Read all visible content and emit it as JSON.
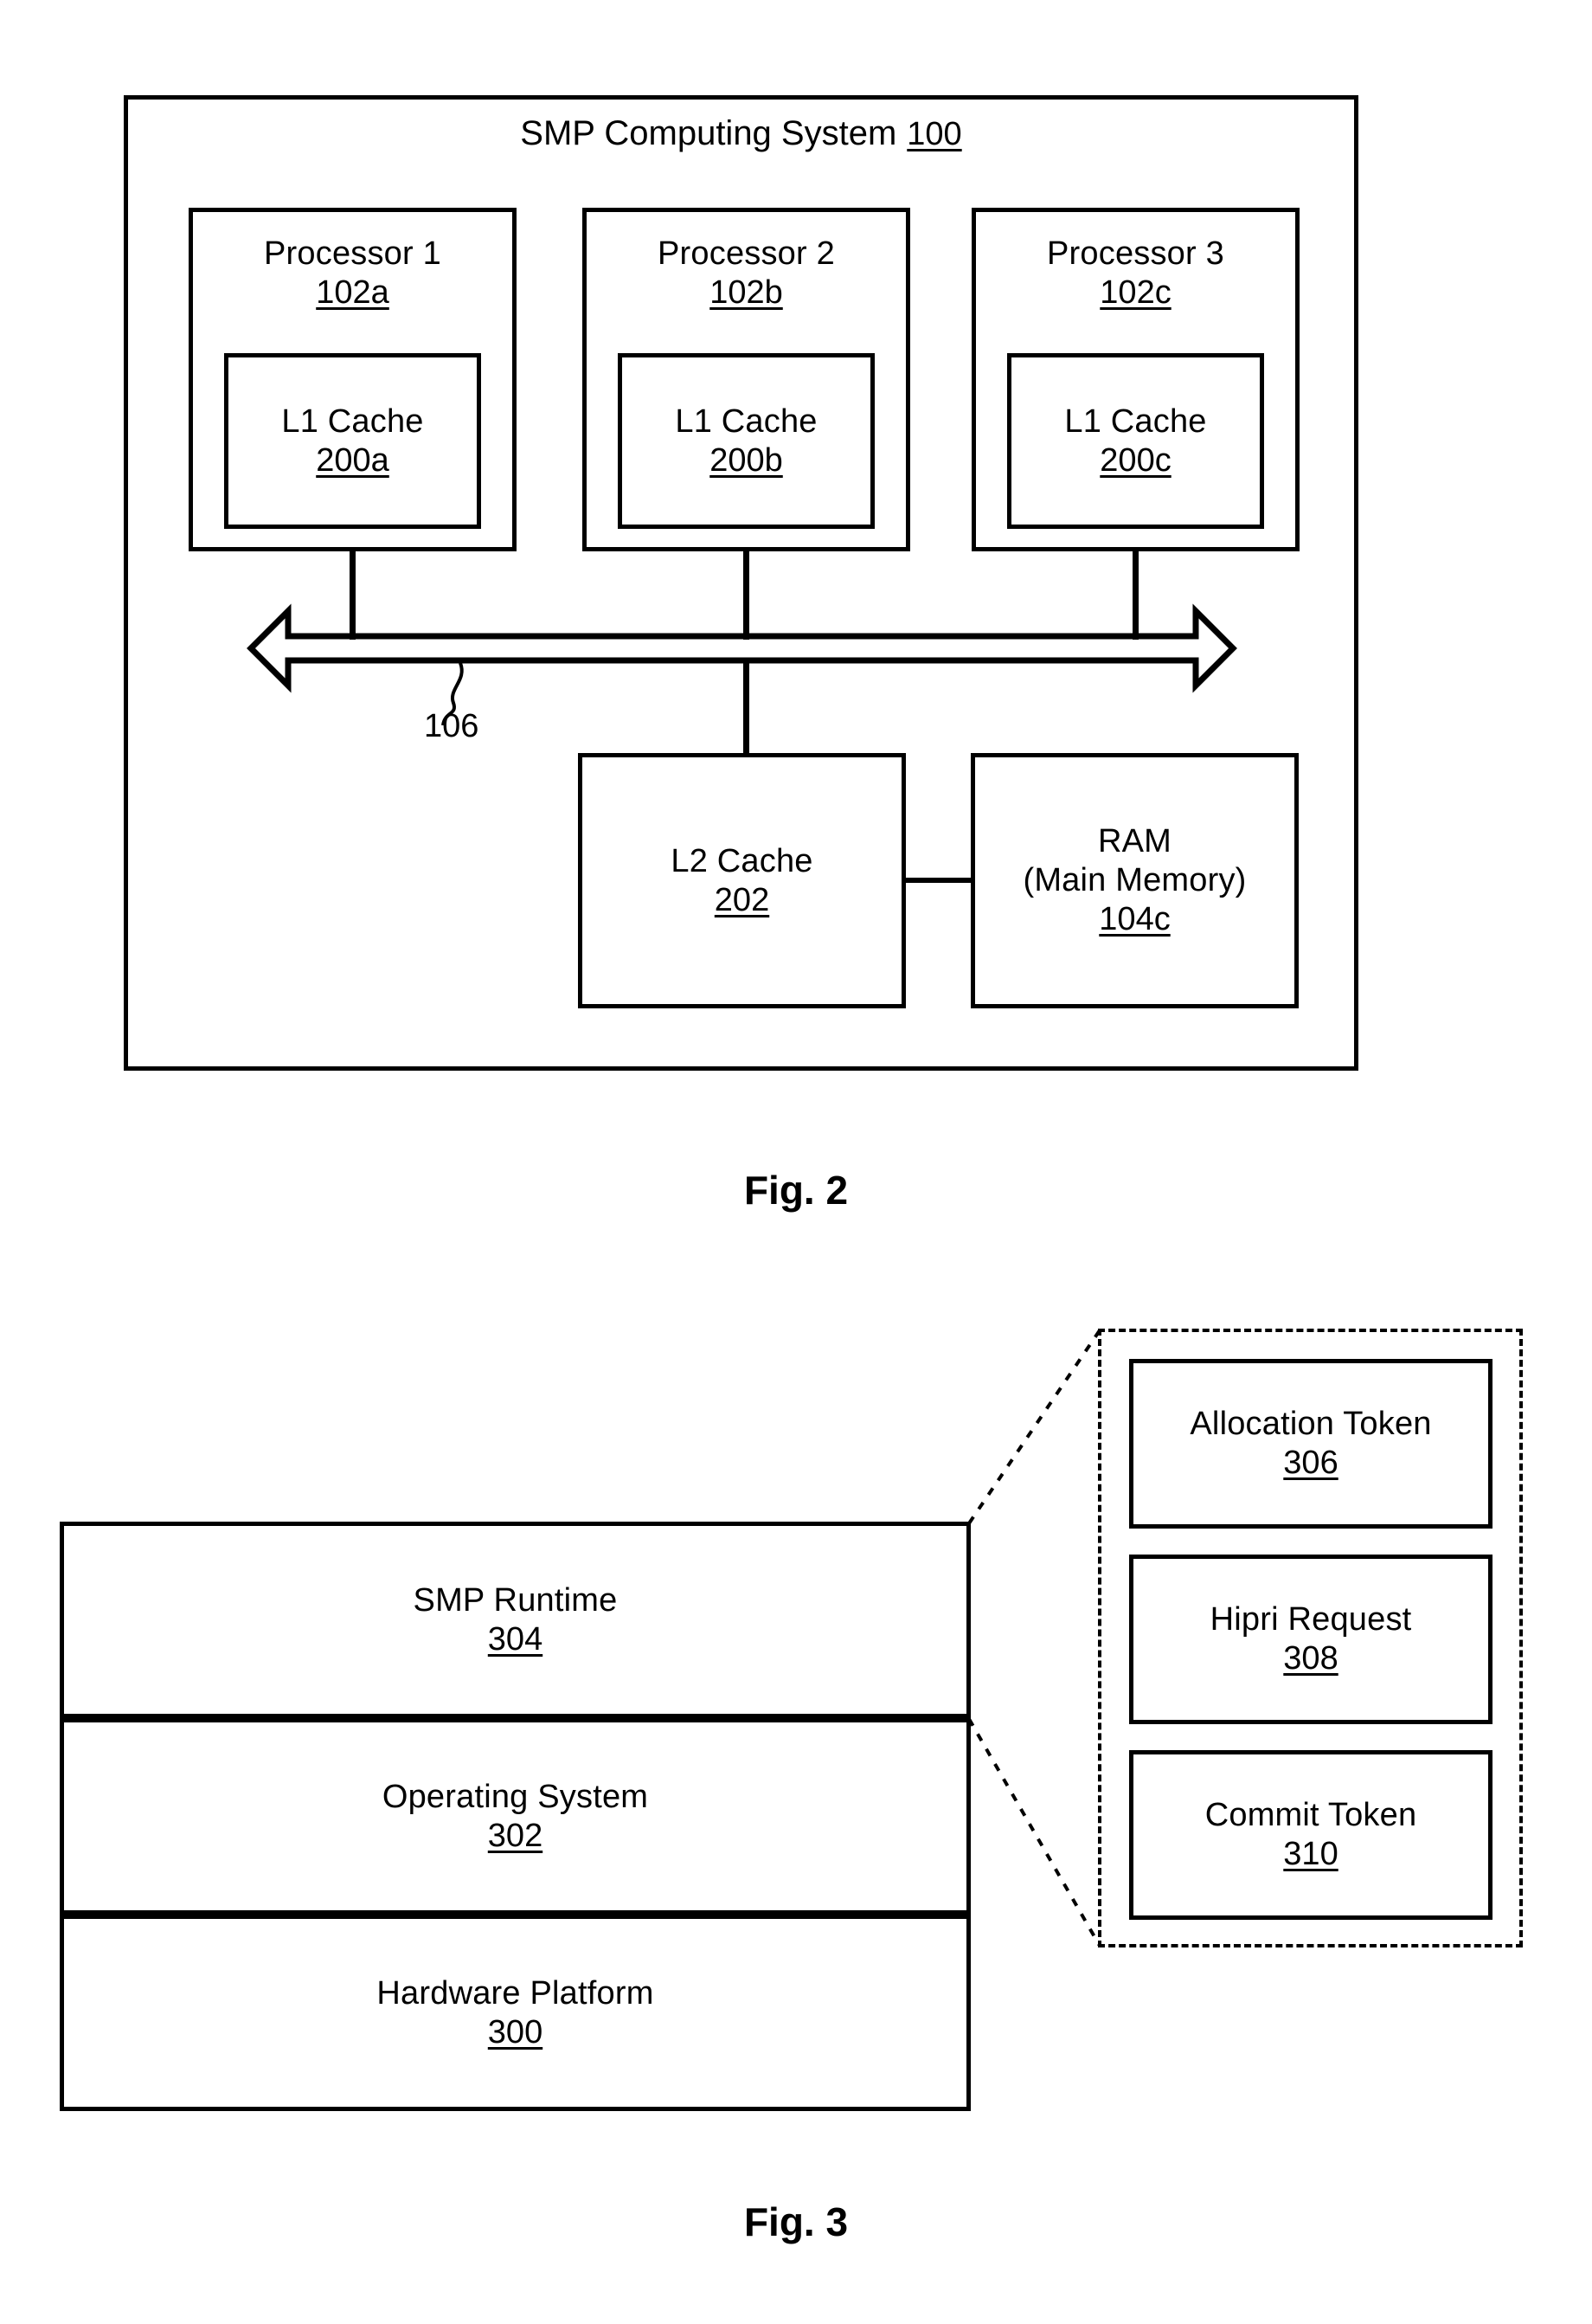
{
  "figure2": {
    "caption": "Fig. 2",
    "system": {
      "title": "SMP Computing System",
      "ref": "100"
    },
    "bus": {
      "ref": "106"
    },
    "processors": [
      {
        "label": "Processor 1",
        "ref": "102a",
        "cache": {
          "label": "L1 Cache",
          "ref": "200a"
        }
      },
      {
        "label": "Processor 2",
        "ref": "102b",
        "cache": {
          "label": "L1 Cache",
          "ref": "200b"
        }
      },
      {
        "label": "Processor 3",
        "ref": "102c",
        "cache": {
          "label": "L1 Cache",
          "ref": "200c"
        }
      }
    ],
    "l2_cache": {
      "label": "L2 Cache",
      "ref": "202"
    },
    "ram": {
      "line1": "RAM",
      "line2": "(Main Memory)",
      "ref": "104c"
    }
  },
  "figure3": {
    "caption": "Fig. 3",
    "stack": [
      {
        "label": "SMP Runtime",
        "ref": "304"
      },
      {
        "label": "Operating System",
        "ref": "302"
      },
      {
        "label": "Hardware Platform",
        "ref": "300"
      }
    ],
    "callout": [
      {
        "label": "Allocation Token",
        "ref": "306"
      },
      {
        "label": "Hipri Request",
        "ref": "308"
      },
      {
        "label": "Commit Token",
        "ref": "310"
      }
    ]
  },
  "colors": {
    "ink": "#000000",
    "paper": "#ffffff"
  }
}
